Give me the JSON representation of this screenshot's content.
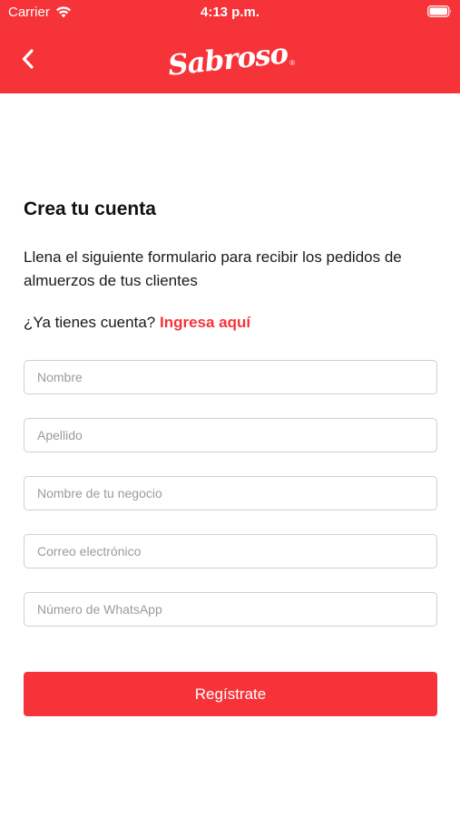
{
  "status_bar": {
    "carrier": "Carrier",
    "time": "4:13 p.m."
  },
  "nav": {
    "logo_text": "Sabroso",
    "logo_mark": "®",
    "back_icon": "chevron-left-icon"
  },
  "colors": {
    "brand": "#f63338",
    "field_border": "#cfcfcf",
    "placeholder": "#9b9b9b"
  },
  "form": {
    "title": "Crea tu cuenta",
    "subtitle": "Llena el siguiente formulario para recibir los pedidos de almuerzos de tus clientes",
    "login_prompt": "¿Ya tienes cuenta?",
    "login_link": "Ingresa aquí",
    "fields": {
      "first_name": {
        "value": "",
        "placeholder": "Nombre"
      },
      "last_name": {
        "value": "",
        "placeholder": "Apellido"
      },
      "business_name": {
        "value": "",
        "placeholder": "Nombre de tu negocio"
      },
      "email": {
        "value": "",
        "placeholder": "Correo electrónico"
      },
      "whatsapp": {
        "value": "",
        "placeholder": "Número de WhatsApp"
      }
    },
    "submit_label": "Regístrate"
  }
}
